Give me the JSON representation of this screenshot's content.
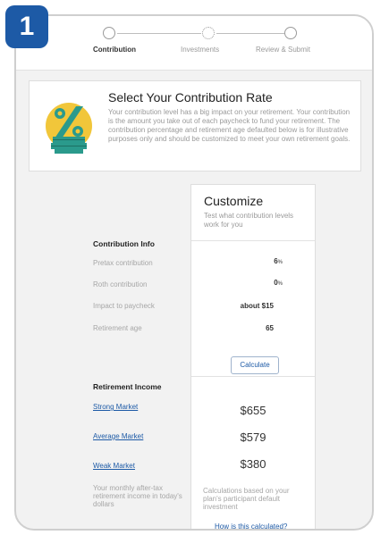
{
  "badge": "1",
  "steps": [
    {
      "label": "Contribution",
      "state": "active"
    },
    {
      "label": "Investments",
      "state": "pending"
    },
    {
      "label": "Review & Submit",
      "state": "pending"
    }
  ],
  "intro": {
    "title": "Select Your Contribution Rate",
    "text": "Your contribution level has a big impact on your retirement. Your contribution is the amount you take out of each paycheck to fund your retirement. The contribution percentage and retirement age defaulted below is for illustrative purposes only and should be customized to meet your own retirement goals.",
    "icon": "percent-money-icon"
  },
  "customize": {
    "title": "Customize",
    "subtitle": "Test what contribution levels work for you"
  },
  "contribution_info": {
    "heading": "Contribution Info",
    "pretax_label": "Pretax contribution",
    "pretax_value": "6",
    "roth_label": "Roth contribution",
    "roth_value": "0",
    "percent_unit": "%",
    "impact_label": "Impact to paycheck",
    "impact_value": "about $15",
    "age_label": "Retirement age",
    "age_value": "65",
    "calculate_label": "Calculate"
  },
  "retirement_income": {
    "heading": "Retirement Income",
    "rows": [
      {
        "label": "Strong Market",
        "value": "$655"
      },
      {
        "label": "Average Market",
        "value": "$579"
      },
      {
        "label": "Weak Market",
        "value": "$380"
      }
    ],
    "note_left": "Your monthly after-tax retirement income in today's dollars",
    "note_right": "Calculations based on your plan's participant default investment",
    "how_link": "How is this calculated?"
  },
  "colors": {
    "accent": "#1d5aa6",
    "icon_yellow": "#f1c63a",
    "icon_teal": "#2a9a8c"
  }
}
